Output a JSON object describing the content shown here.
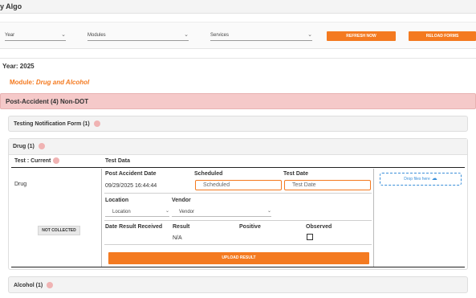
{
  "app": {
    "title": "y Algo"
  },
  "filters": {
    "year_label": "Year",
    "modules_label": "Modules",
    "services_label": "Services",
    "refresh_label": "REFRESH NOW",
    "reload_label": "RELOAD FORMS"
  },
  "year_heading": "Year: 2025",
  "module": {
    "prefix": "Module: ",
    "name": "Drug and Alcohol"
  },
  "section": {
    "title": "Post-Accident (4) Non-DOT"
  },
  "tnf_card": {
    "title": "Testing Notification Form (1)"
  },
  "drug_card": {
    "title": "Drug (1)",
    "test_current_label": "Test : Current",
    "test_data_label": "Test Data",
    "drug_name": "Drug",
    "status_badge": "NOT COLLECTED",
    "post_accident_date_label": "Post Accident Date",
    "post_accident_date_value": "09/29/2025 16:44:44",
    "scheduled_label": "Scheduled",
    "scheduled_placeholder": "Scheduled",
    "test_date_label": "Test Date",
    "test_date_placeholder": "Test Date",
    "location_label": "Location",
    "location_select": "Location",
    "vendor_label": "Vendor",
    "vendor_select": "Vendor",
    "date_result_label": "Date Result Received",
    "result_label": "Result",
    "result_value": "N/A",
    "positive_label": "Positive",
    "observed_label": "Observed",
    "upload_label": "UPLOAD RESULT",
    "drop_label": "Drop files here"
  },
  "alcohol_card": {
    "title": "Alcohol (1)"
  },
  "colors": {
    "accent": "#f47a20",
    "section_bg": "#f5c9c9",
    "dot": "#f0b3b3",
    "drop": "#3a8fd9"
  },
  "icons": [
    "chevron-down-icon",
    "cloud-upload-icon",
    "status-dot-icon"
  ]
}
